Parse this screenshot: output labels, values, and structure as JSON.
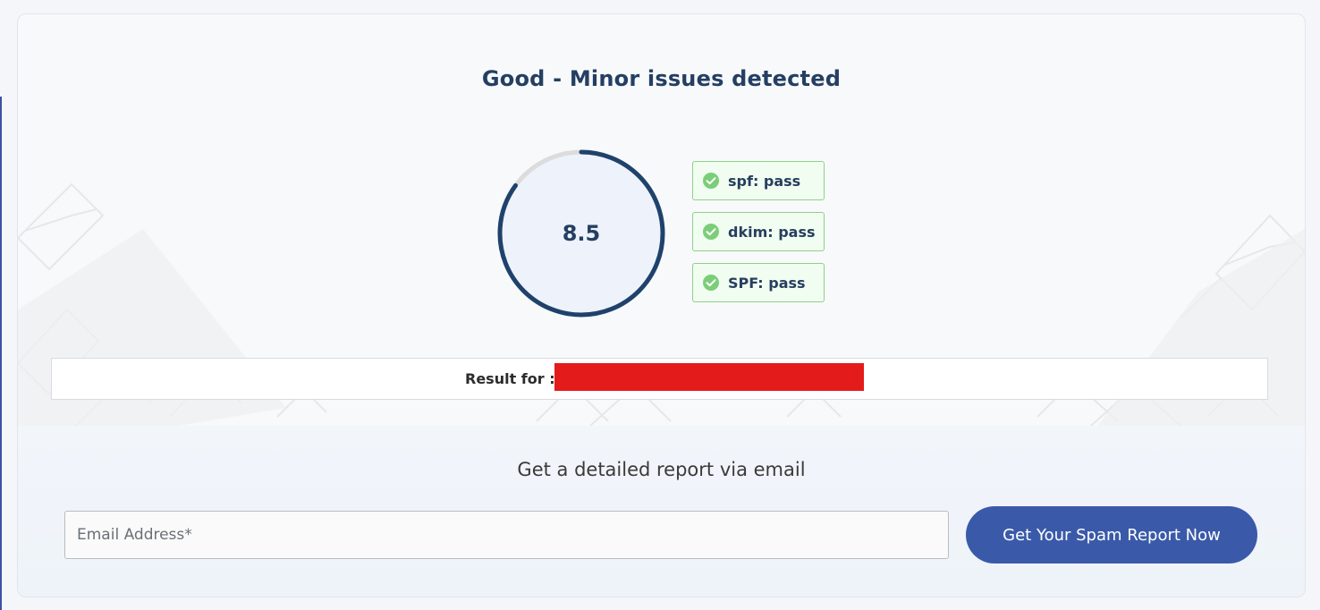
{
  "result": {
    "status_title": "Good - Minor issues detected",
    "score": "8.5",
    "score_progress": 0.85,
    "checks": [
      {
        "label": "spf: pass",
        "icon": "check-circle-icon",
        "state": "pass"
      },
      {
        "label": "dkim: pass",
        "icon": "check-circle-icon",
        "state": "pass"
      },
      {
        "label": "SPF: pass",
        "icon": "check-circle-icon",
        "state": "pass"
      }
    ],
    "result_for_label": "Result for :"
  },
  "report": {
    "heading": "Get a detailed report via email",
    "email_placeholder": "Email Address*",
    "email_value": "",
    "submit_label": "Get Your Spam Report Now"
  },
  "colors": {
    "accent": "#3a5aa9",
    "gauge_progress": "#1f426c",
    "gauge_track": "#dcdcdc",
    "pass_green": "#8fd08a",
    "redaction": "#e41b1b"
  }
}
